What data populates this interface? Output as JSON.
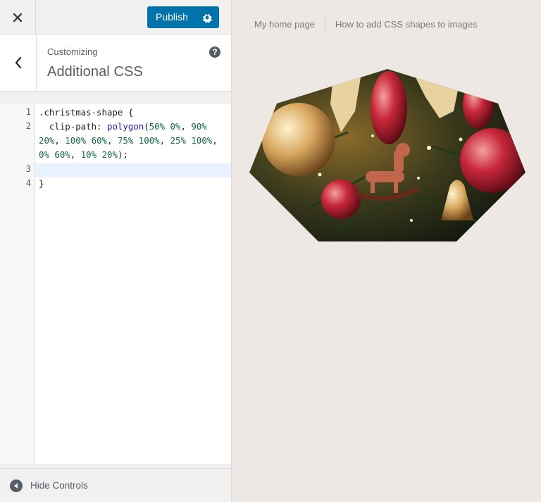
{
  "topbar": {
    "close_icon": "close-icon",
    "publish_label": "Publish",
    "gear_icon": "gear-icon"
  },
  "section": {
    "sub_label": "Customizing",
    "title": "Additional CSS",
    "help": "?"
  },
  "editor": {
    "line_numbers": [
      "1",
      "2",
      "3",
      "4"
    ],
    "lines": [
      ".christmas-shape {",
      "  clip-path: polygon(50% 0%, 90%",
      "20%, 100% 60%, 75% 100%, 25% 100%,",
      "0% 60%, 10% 20%);",
      "",
      "}"
    ]
  },
  "bottom": {
    "hide_label": "Hide Controls"
  },
  "preview": {
    "nav": [
      "My home page",
      "How to add CSS shapes to images"
    ]
  },
  "colors": {
    "accent": "#0073aa",
    "preview_bg": "#ede8e3",
    "panel_bg": "#f1f1f1"
  }
}
